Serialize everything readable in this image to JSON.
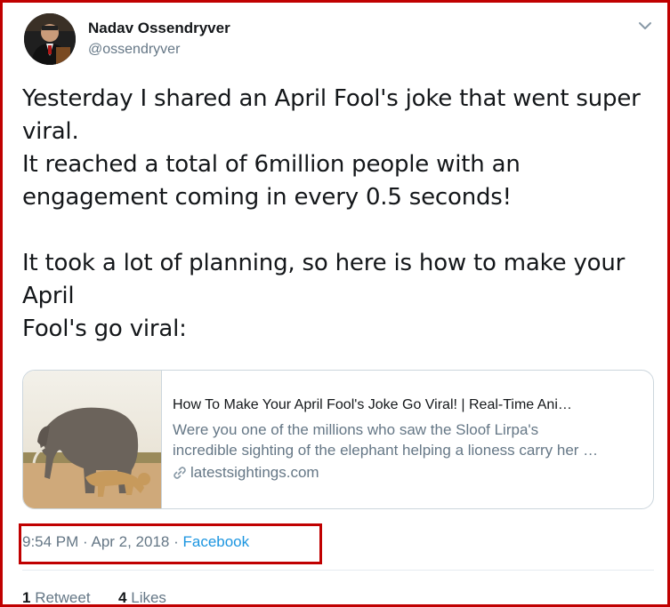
{
  "author": {
    "name": "Nadav Ossendryver",
    "handle": "@ossendryver"
  },
  "tweet": {
    "lines": [
      "Yesterday I shared an April Fool's joke that went super",
      "viral.",
      "It reached a total of 6million people with an",
      "engagement coming in every 0.5 seconds!",
      "",
      "It took a lot of planning, so here is how to make your",
      "April",
      "Fool's go viral:"
    ]
  },
  "card": {
    "title": "How To Make Your April Fool's Joke Go Viral! | Real-Time Ani…",
    "description_lines": [
      "Were you one of the millions who saw the Sloof Lirpa's",
      "incredible sighting of the elephant helping a lioness carry her …"
    ],
    "domain": "latestsightings.com"
  },
  "meta": {
    "time_date": "9:54 PM · Apr 2, 2018 · ",
    "source": "Facebook"
  },
  "stats": {
    "retweets_count": "1",
    "retweets_label": "Retweet",
    "likes_count": "4",
    "likes_label": "Likes"
  },
  "colors": {
    "highlight_border": "#c00000",
    "link": "#1b95e0",
    "muted": "#657786"
  },
  "icons": {
    "menu": "chevron-down-icon",
    "card_link": "link-icon"
  }
}
